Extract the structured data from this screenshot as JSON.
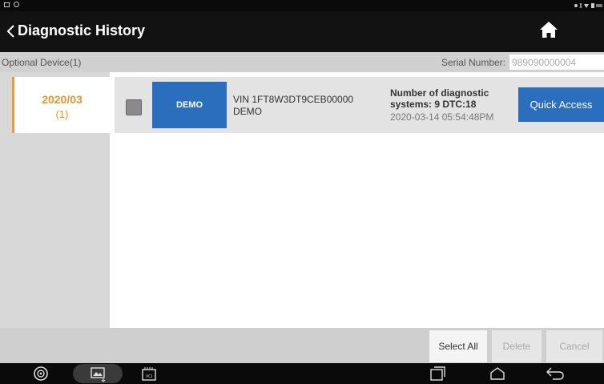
{
  "header": {
    "title": "Diagnostic History"
  },
  "infobar": {
    "device_label": "Optional Device(1)",
    "serial_label": "Serial Number:",
    "serial_value": "989090000004"
  },
  "sidebar": {
    "tabs": [
      {
        "date": "2020/03",
        "count": "(1)"
      }
    ]
  },
  "records": [
    {
      "thumb_label": "DEMO",
      "vin_line": "VIN 1FT8W3DT9CEB00000",
      "make_line": "DEMO",
      "diag_line1": "Number of diagnostic",
      "diag_line2": "systems: 9 DTC:18",
      "timestamp": "2020-03-14 05:54:48PM",
      "action_label": "Quick Access"
    }
  ],
  "actions": {
    "select_all": "Select All",
    "delete": "Delete",
    "cancel": "Cancel"
  },
  "colors": {
    "accent_orange": "#f0922e",
    "accent_blue": "#2a6ebd",
    "titlebar_bg": "#121212"
  },
  "icons": [
    "back-icon",
    "home-icon",
    "browser-icon",
    "screenshot-icon",
    "vci-icon",
    "recent-apps-icon",
    "home-nav-icon",
    "back-nav-icon"
  ]
}
